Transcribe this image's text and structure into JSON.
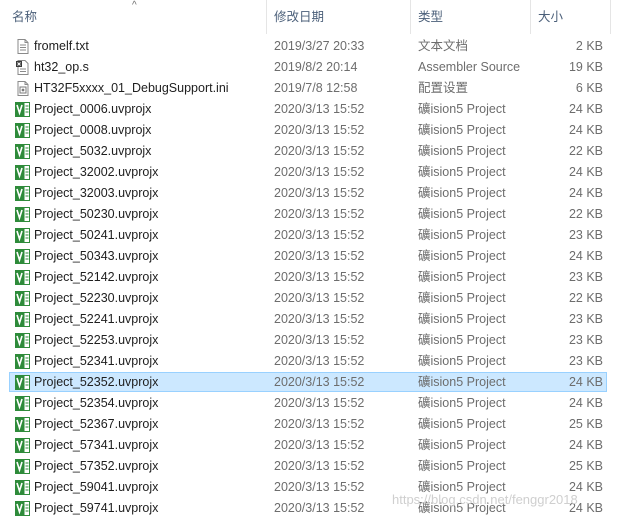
{
  "columns": {
    "name": "名称",
    "date": "修改日期",
    "type": "类型",
    "size": "大小",
    "sort_indicator": "^"
  },
  "files": [
    {
      "name": "fromelf.txt",
      "date": "2019/3/27 20:33",
      "type": "文本文档",
      "size": "2 KB",
      "icon": "text-file-icon"
    },
    {
      "name": "ht32_op.s",
      "date": "2019/8/2 20:14",
      "type": "Assembler Source",
      "size": "19 KB",
      "icon": "assembler-file-icon"
    },
    {
      "name": "HT32F5xxxx_01_DebugSupport.ini",
      "date": "2019/7/8 12:58",
      "type": "配置设置",
      "size": "6 KB",
      "icon": "ini-file-icon"
    },
    {
      "name": "Project_0006.uvprojx",
      "date": "2020/3/13 15:52",
      "type": "礦ision5 Project",
      "size": "24 KB",
      "icon": "uvision-project-icon"
    },
    {
      "name": "Project_0008.uvprojx",
      "date": "2020/3/13 15:52",
      "type": "礦ision5 Project",
      "size": "24 KB",
      "icon": "uvision-project-icon"
    },
    {
      "name": "Project_5032.uvprojx",
      "date": "2020/3/13 15:52",
      "type": "礦ision5 Project",
      "size": "22 KB",
      "icon": "uvision-project-icon"
    },
    {
      "name": "Project_32002.uvprojx",
      "date": "2020/3/13 15:52",
      "type": "礦ision5 Project",
      "size": "24 KB",
      "icon": "uvision-project-icon"
    },
    {
      "name": "Project_32003.uvprojx",
      "date": "2020/3/13 15:52",
      "type": "礦ision5 Project",
      "size": "24 KB",
      "icon": "uvision-project-icon"
    },
    {
      "name": "Project_50230.uvprojx",
      "date": "2020/3/13 15:52",
      "type": "礦ision5 Project",
      "size": "22 KB",
      "icon": "uvision-project-icon"
    },
    {
      "name": "Project_50241.uvprojx",
      "date": "2020/3/13 15:52",
      "type": "礦ision5 Project",
      "size": "23 KB",
      "icon": "uvision-project-icon"
    },
    {
      "name": "Project_50343.uvprojx",
      "date": "2020/3/13 15:52",
      "type": "礦ision5 Project",
      "size": "24 KB",
      "icon": "uvision-project-icon"
    },
    {
      "name": "Project_52142.uvprojx",
      "date": "2020/3/13 15:52",
      "type": "礦ision5 Project",
      "size": "23 KB",
      "icon": "uvision-project-icon"
    },
    {
      "name": "Project_52230.uvprojx",
      "date": "2020/3/13 15:52",
      "type": "礦ision5 Project",
      "size": "22 KB",
      "icon": "uvision-project-icon"
    },
    {
      "name": "Project_52241.uvprojx",
      "date": "2020/3/13 15:52",
      "type": "礦ision5 Project",
      "size": "23 KB",
      "icon": "uvision-project-icon"
    },
    {
      "name": "Project_52253.uvprojx",
      "date": "2020/3/13 15:52",
      "type": "礦ision5 Project",
      "size": "23 KB",
      "icon": "uvision-project-icon"
    },
    {
      "name": "Project_52341.uvprojx",
      "date": "2020/3/13 15:52",
      "type": "礦ision5 Project",
      "size": "23 KB",
      "icon": "uvision-project-icon"
    },
    {
      "name": "Project_52352.uvprojx",
      "date": "2020/3/13 15:52",
      "type": "礦ision5 Project",
      "size": "24 KB",
      "icon": "uvision-project-icon",
      "selected": true
    },
    {
      "name": "Project_52354.uvprojx",
      "date": "2020/3/13 15:52",
      "type": "礦ision5 Project",
      "size": "24 KB",
      "icon": "uvision-project-icon"
    },
    {
      "name": "Project_52367.uvprojx",
      "date": "2020/3/13 15:52",
      "type": "礦ision5 Project",
      "size": "25 KB",
      "icon": "uvision-project-icon"
    },
    {
      "name": "Project_57341.uvprojx",
      "date": "2020/3/13 15:52",
      "type": "礦ision5 Project",
      "size": "24 KB",
      "icon": "uvision-project-icon"
    },
    {
      "name": "Project_57352.uvprojx",
      "date": "2020/3/13 15:52",
      "type": "礦ision5 Project",
      "size": "25 KB",
      "icon": "uvision-project-icon"
    },
    {
      "name": "Project_59041.uvprojx",
      "date": "2020/3/13 15:52",
      "type": "礦ision5 Project",
      "size": "24 KB",
      "icon": "uvision-project-icon"
    },
    {
      "name": "Project_59741.uvprojx",
      "date": "2020/3/13 15:52",
      "type": "礦ision5 Project",
      "size": "24 KB",
      "icon": "uvision-project-icon"
    }
  ],
  "watermark": "https://blog.csdn.net/fenggr2018",
  "colors": {
    "header_text": "#4c607a",
    "selection_bg": "#cce8ff",
    "selection_border": "#99d1ff",
    "uvision_green": "#2e8b3a"
  }
}
